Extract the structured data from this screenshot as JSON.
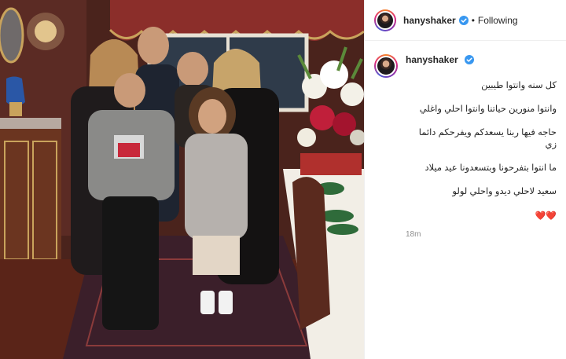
{
  "post": {
    "author": {
      "username": "hanyshaker",
      "verified": true,
      "follow_status": "Following"
    },
    "caption": {
      "lines": [
        "كل سنه وانتوا طيبين",
        "وانتوا منورين حياتنا وانتوا احلي واغلي",
        "حاجه فيها ربنا يسعدكم ويفرحكم دائما زي",
        "ما انتوا بتفرحونا وبتسعدونا عيد ميلاد",
        "سعيد لاحلي ديدو واحلي لولو"
      ],
      "emoji": "❤️❤️"
    },
    "time_ago": "18m",
    "photo": {
      "icon": "family-photo"
    }
  },
  "colors": {
    "verified_badge": "#3897f0",
    "heart": "#d8162b",
    "muted_text": "#8e8e8e",
    "border": "#efefef"
  }
}
